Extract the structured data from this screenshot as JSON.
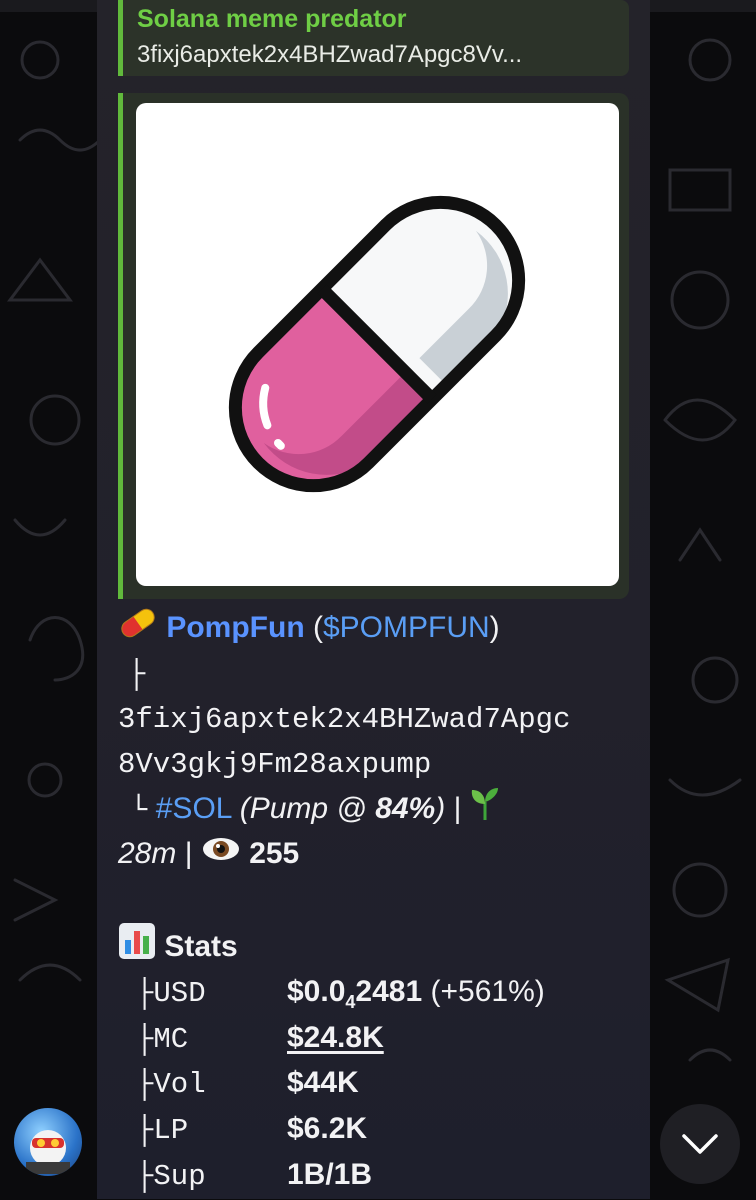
{
  "reply": {
    "sender": "Solana meme predator",
    "text": "3fixj6apxtek2x4BHZwad7Apgc8Vv..."
  },
  "token": {
    "name": "PompFun",
    "ticker_open": " (",
    "ticker": "$POMPFUN",
    "ticker_close": ")",
    "tree_top": "├",
    "address_line1": "3fixj6apxtek2x4BHZwad7Apgc",
    "address_line2": "8Vv3gkj9Fm28axpump",
    "tree_end": "└",
    "chain": "#SOL",
    "pump_prefix": "(Pump @ ",
    "pump_pct": "84%",
    "pump_suffix": ")",
    "sep": "|",
    "age": "28m",
    "views": "255"
  },
  "stats": {
    "title": "Stats",
    "rows": [
      {
        "tree": "├",
        "label": "USD",
        "value_main": "$0.0",
        "value_sub": "4",
        "value_rest": "2481",
        "change": "(+561%)"
      },
      {
        "tree": "├",
        "label": "MC",
        "value": "$24.8K"
      },
      {
        "tree": "├",
        "label": "Vol",
        "value": "$44K"
      },
      {
        "tree": "├",
        "label": "LP",
        "value": "$6.2K"
      },
      {
        "tree": "├",
        "label": "Sup",
        "value": "1B/1B"
      }
    ]
  },
  "colors": {
    "accent_green": "#61b93c",
    "link_blue": "#5a9ef5",
    "pill_pink": "#e0609e"
  },
  "icons": {
    "pill": "pill-icon",
    "seedling": "seedling-icon",
    "eye": "eye-icon",
    "chart": "bar-chart-icon",
    "scroll_down": "chevron-down-icon"
  }
}
